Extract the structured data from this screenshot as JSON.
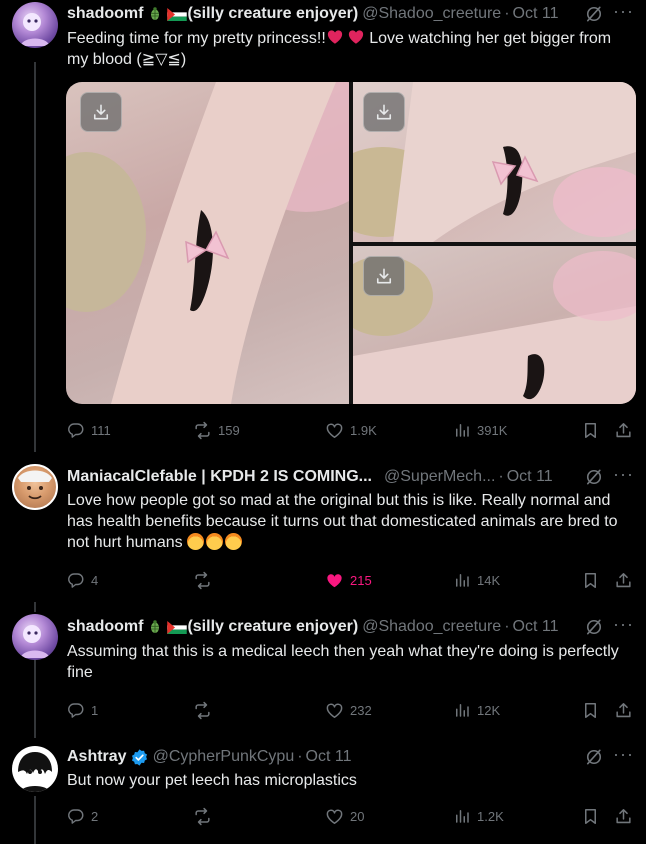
{
  "tweets": [
    {
      "name": "shadoomf",
      "name_suffix": "(silly creature enjoyer)",
      "handle": "@Shadoo_creeture",
      "date": "Oct 11",
      "text_a": "Feeding time for my pretty princess!!",
      "text_b": " Love watching her get bigger from my blood  (≧▽≦)",
      "stats": {
        "replies": "111",
        "reposts": "159",
        "likes": "1.9K",
        "views": "391K"
      }
    },
    {
      "name": "ManiacalClefable | KPDH 2 IS COMING...",
      "handle": "@SuperMech...",
      "date": "Oct 11",
      "text": "Love how people got so mad at the original but this is like. Really normal and has health benefits because it turns out that domesticated animals are bred to not hurt humans ",
      "stats": {
        "replies": "4",
        "reposts": "",
        "likes": "215",
        "views": "14K"
      }
    },
    {
      "name": "shadoomf",
      "name_suffix": "(silly creature enjoyer)",
      "handle": "@Shadoo_creeture",
      "date": "Oct 11",
      "text": "Assuming that this is a medical leech then yeah what they're doing is perfectly fine",
      "stats": {
        "replies": "1",
        "reposts": "",
        "likes": "232",
        "views": "12K"
      }
    },
    {
      "name": "Ashtray",
      "handle": "@CypherPunkCypu",
      "date": "Oct 11",
      "text": "But now your pet leech has microplastics",
      "stats": {
        "replies": "2",
        "reposts": "",
        "likes": "20",
        "views": "1.2K"
      }
    }
  ],
  "ui": {
    "dot": "·",
    "more": "···"
  },
  "colors": {
    "like_active": "#f91880",
    "muted": "#71767b",
    "text": "#e7e9ea",
    "verified": "#1d9bf0"
  }
}
